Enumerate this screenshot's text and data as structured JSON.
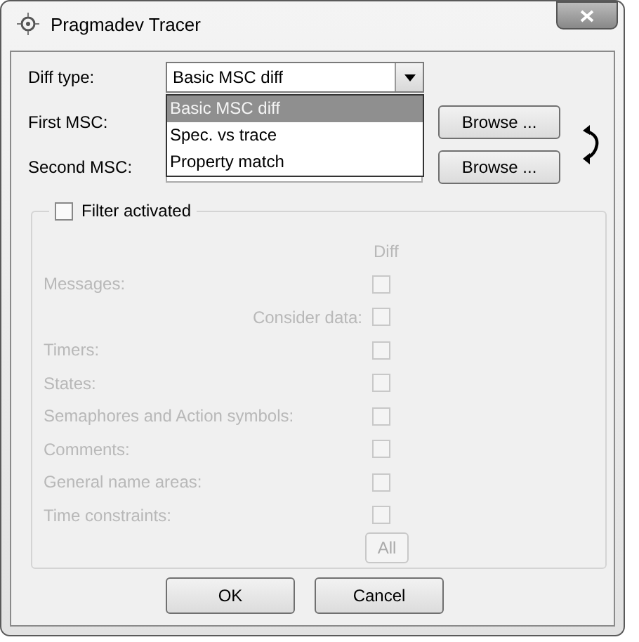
{
  "window": {
    "title": "Pragmadev Tracer"
  },
  "diff_type": {
    "label": "Diff type:",
    "value": "Basic MSC diff",
    "expanded": true,
    "options": [
      {
        "label": "Basic MSC diff",
        "selected": true
      },
      {
        "label": "Spec. vs trace",
        "selected": false
      },
      {
        "label": "Property match",
        "selected": false
      }
    ]
  },
  "msc_fields": [
    {
      "label": "First MSC:",
      "button": "Browse ..."
    },
    {
      "label": "Second MSC:",
      "button": "Browse ..."
    }
  ],
  "filter": {
    "label": "Filter activated",
    "checked": false,
    "column_header": "Diff",
    "rows": [
      {
        "label": "Messages:",
        "kind": "main",
        "checked": false
      },
      {
        "label": "Consider data:",
        "kind": "sub",
        "checked": false
      },
      {
        "label": "Timers:",
        "kind": "main",
        "checked": false
      },
      {
        "label": "States:",
        "kind": "main",
        "checked": false
      },
      {
        "label": "Semaphores and Action symbols:",
        "kind": "main",
        "checked": false
      },
      {
        "label": "Comments:",
        "kind": "main",
        "checked": false
      },
      {
        "label": "General name areas:",
        "kind": "main",
        "checked": false
      },
      {
        "label": "Time constraints:",
        "kind": "main",
        "checked": false
      }
    ],
    "all_button": "All"
  },
  "buttons": [
    "OK",
    "Cancel"
  ]
}
